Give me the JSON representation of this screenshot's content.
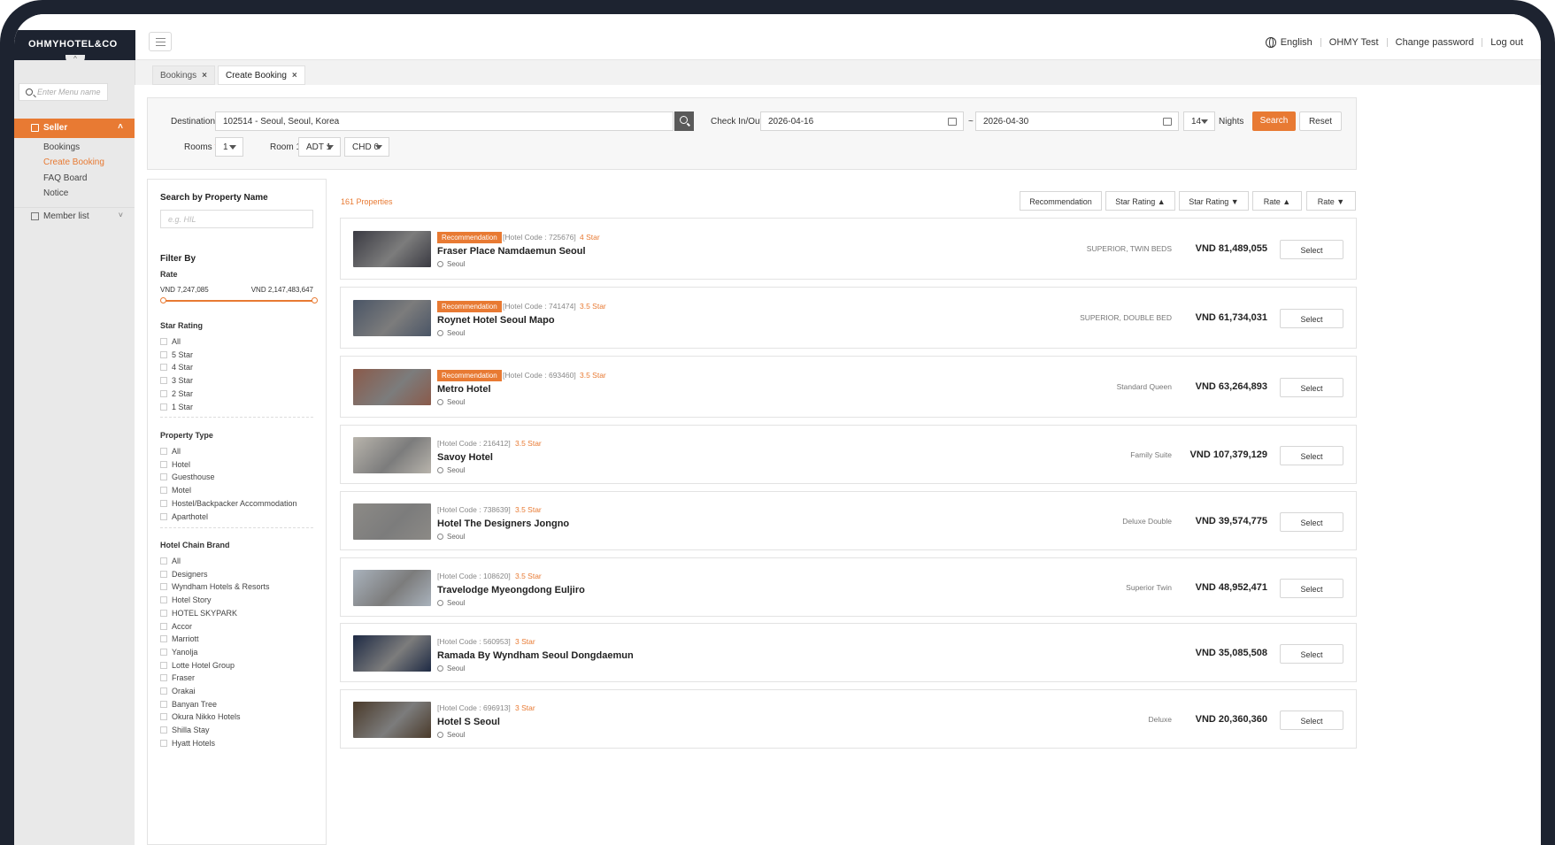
{
  "brand": {
    "logo_text": "OHMYHOTEL&CO"
  },
  "topbar": {
    "language": "English",
    "user": "OHMY Test",
    "change_password": "Change password",
    "logout": "Log out"
  },
  "sidebar": {
    "search_placeholder": "Enter Menu name",
    "seller_label": "Seller",
    "items": [
      "Bookings",
      "Create Booking",
      "FAQ Board",
      "Notice"
    ],
    "member_label": "Member list"
  },
  "tabs": [
    {
      "label": "Bookings"
    },
    {
      "label": "Create Booking"
    }
  ],
  "search": {
    "destination_label": "Destination",
    "destination_value": "102514 - Seoul, Seoul, Korea",
    "checkin_label": "Check In/Out",
    "checkin_value": "2026-04-16",
    "dash": "~",
    "checkout_value": "2026-04-30",
    "nights_value": "14",
    "nights_label": "Nights",
    "search_button": "Search",
    "reset_button": "Reset",
    "rooms_label": "Rooms",
    "rooms_value": "1",
    "room1_label": "Room 1",
    "adults_value": "ADT 1",
    "children_value": "CHD 0",
    "required_mark": "*"
  },
  "filter": {
    "property_name_title": "Search by Property Name",
    "property_name_placeholder": "e.g. HIL",
    "filter_by": "Filter By",
    "rate_label": "Rate",
    "rate_min": "VND 7,247,085",
    "rate_max": "VND 2,147,483,647",
    "star_rating_label": "Star Rating",
    "star_options": [
      "All",
      "5 Star",
      "4 Star",
      "3 Star",
      "2 Star",
      "1 Star"
    ],
    "property_type_label": "Property Type",
    "property_types": [
      "All",
      "Hotel",
      "Guesthouse",
      "Motel",
      "Hostel/Backpacker Accommodation",
      "Aparthotel"
    ],
    "chain_label": "Hotel Chain Brand",
    "chains": [
      "All",
      "Designers",
      "Wyndham Hotels & Resorts",
      "Hotel Story",
      "HOTEL SKYPARK",
      "Accor",
      "Marriott",
      "Yanolja",
      "Lotte Hotel Group",
      "Fraser",
      "Orakai",
      "Banyan Tree",
      "Okura Nikko Hotels",
      "Shilla Stay",
      "Hyatt Hotels"
    ]
  },
  "results": {
    "count": "161 Properties",
    "sort_buttons": [
      "Recommendation",
      "Star Rating ▲",
      "Star Rating ▼",
      "Rate ▲",
      "Rate ▼"
    ],
    "select_label": "Select",
    "hotels": [
      {
        "badge": "Recommendation",
        "code": "[Hotel Code : 725676]",
        "star": "4 Star",
        "name": "Fraser Place Namdaemun Seoul",
        "city": "Seoul",
        "room": "SUPERIOR, TWIN BEDS",
        "price": "VND 81,489,055",
        "thumb_color": "#3a3a42"
      },
      {
        "badge": "Recommendation",
        "code": "[Hotel Code : 741474]",
        "star": "3.5 Star",
        "name": "Roynet Hotel Seoul Mapo",
        "city": "Seoul",
        "room": "SUPERIOR, DOUBLE BED",
        "price": "VND 61,734,031",
        "thumb_color": "#4a5566"
      },
      {
        "badge": "Recommendation",
        "code": "[Hotel Code : 693460]",
        "star": "3.5 Star",
        "name": "Metro Hotel",
        "city": "Seoul",
        "room": "Standard Queen",
        "price": "VND 63,264,893",
        "thumb_color": "#8a5a4a"
      },
      {
        "badge": "",
        "code": "[Hotel Code : 216412]",
        "star": "3.5 Star",
        "name": "Savoy Hotel",
        "city": "Seoul",
        "room": "Family Suite",
        "price": "VND 107,379,129",
        "thumb_color": "#b8b4ac"
      },
      {
        "badge": "",
        "code": "[Hotel Code : 738639]",
        "star": "3.5 Star",
        "name": "Hotel The Designers Jongno",
        "city": "Seoul",
        "room": "Deluxe Double",
        "price": "VND 39,574,775",
        "thumb_color": "#8c8a86"
      },
      {
        "badge": "",
        "code": "[Hotel Code : 108620]",
        "star": "3.5 Star",
        "name": "Travelodge Myeongdong Euljiro",
        "city": "Seoul",
        "room": "Superior Twin",
        "price": "VND 48,952,471",
        "thumb_color": "#a9b2bc"
      },
      {
        "badge": "",
        "code": "[Hotel Code : 560953]",
        "star": "3 Star",
        "name": "Ramada By Wyndham Seoul Dongdaemun",
        "city": "Seoul",
        "room": "",
        "price": "VND 35,085,508",
        "thumb_color": "#1e2a44"
      },
      {
        "badge": "",
        "code": "[Hotel Code : 696913]",
        "star": "3 Star",
        "name": "Hotel S Seoul",
        "city": "Seoul",
        "room": "Deluxe",
        "price": "VND 20,360,360",
        "thumb_color": "#4a3a2a"
      }
    ]
  },
  "colors": {
    "accent": "#e87a33",
    "frame": "#1d2330"
  }
}
